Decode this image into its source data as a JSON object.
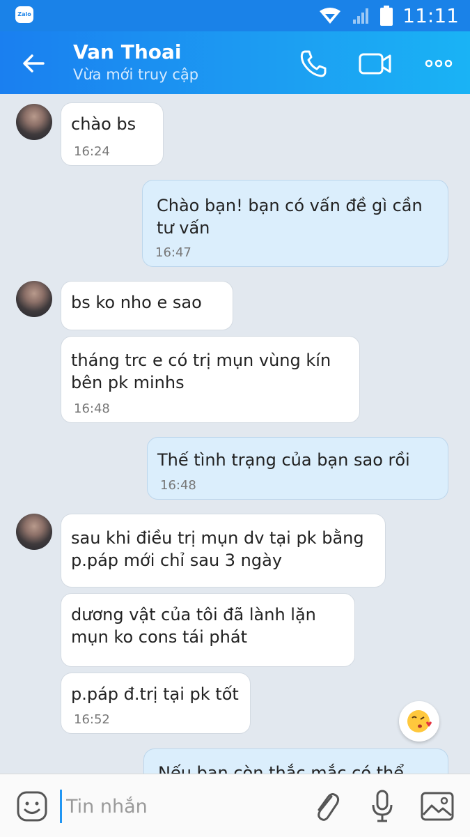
{
  "status_bar": {
    "app_badge": "Zalo",
    "time": "11:11"
  },
  "header": {
    "contact_name": "Van Thoai",
    "contact_status": "Vừa mới truy cập"
  },
  "messages": [
    {
      "text": "chào bs",
      "time": "16:24"
    },
    {
      "text": "Chào bạn! bạn có vấn đề gì cần tư vấn",
      "time": "16:47"
    },
    {
      "text": "bs ko nho e sao",
      "time": ""
    },
    {
      "text": "tháng trc e có trị mụn vùng kín bên pk minhs",
      "time": "16:48"
    },
    {
      "text": "Thế tình trạng của bạn sao rồi",
      "time": "16:48"
    },
    {
      "text": "sau khi điều trị mụn dv tại pk bằng p.páp mới chỉ sau 3 ngày",
      "time": ""
    },
    {
      "text": "dương vật của tôi đã lành lặn mụn ko cons tái phát",
      "time": ""
    },
    {
      "text": "p.páp đ.trị tại pk tốt",
      "time": "16:52"
    },
    {
      "text": "Nếu bạn còn thắc mắc có thể",
      "time": ""
    }
  ],
  "input": {
    "placeholder": "Tin nhắn"
  },
  "icons": {
    "back": "arrow-left-icon",
    "call": "phone-icon",
    "video": "video-camera-icon",
    "more": "more-dots-icon",
    "sticker": "smiley-icon",
    "attach": "paperclip-icon",
    "mic": "microphone-icon",
    "image": "image-icon",
    "emoji_fab": "kiss-emoji-icon"
  },
  "colors": {
    "header": "#1a82e8",
    "incoming_bubble": "#ffffff",
    "outgoing_bubble": "#dbeefc",
    "chat_bg": "#e2e8ef"
  }
}
